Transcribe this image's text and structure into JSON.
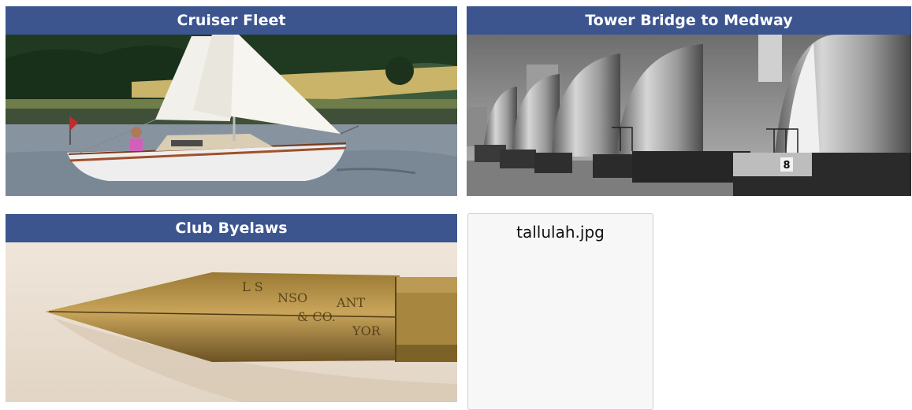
{
  "tiles": [
    {
      "title": "Cruiser Fleet",
      "image": "sailboat-photo"
    },
    {
      "title": "Tower Bridge to Medway",
      "image": "thames-barrier-photo"
    },
    {
      "title": "Club Byelaws",
      "image": "fountain-pen-nib-photo"
    }
  ],
  "broken_image": {
    "alt": "tallulah.jpg"
  },
  "barrier_gate_number": "8",
  "nib_engraving": [
    "L S",
    "NSO",
    "& CO.",
    "ANT",
    "YOR"
  ],
  "colors": {
    "header": "#3c558f",
    "header_text": "#ffffff"
  }
}
